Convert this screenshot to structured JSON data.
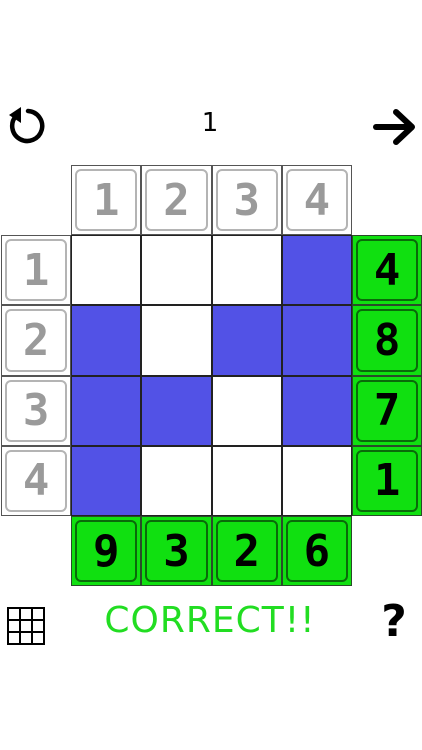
{
  "header": {
    "level": "1",
    "restart_icon": "restart-icon",
    "next_icon": "arrow-right-icon"
  },
  "puzzle": {
    "size": 4,
    "column_clues": [
      "1",
      "2",
      "3",
      "4"
    ],
    "row_clues": [
      "1",
      "2",
      "3",
      "4"
    ],
    "grid": [
      [
        0,
        0,
        0,
        1
      ],
      [
        1,
        0,
        1,
        1
      ],
      [
        1,
        1,
        0,
        1
      ],
      [
        1,
        0,
        0,
        0
      ]
    ],
    "row_sums": [
      "4",
      "8",
      "7",
      "1"
    ],
    "column_sums": [
      "9",
      "3",
      "2",
      "6"
    ]
  },
  "footer": {
    "status": "CORRECT!!",
    "grid_icon": "grid-icon",
    "help_label": "?"
  },
  "colors": {
    "filled": "#5252e6",
    "sum_background": "#10e010",
    "status_text": "#22dd22",
    "clue_text": "#9a9a9a"
  }
}
